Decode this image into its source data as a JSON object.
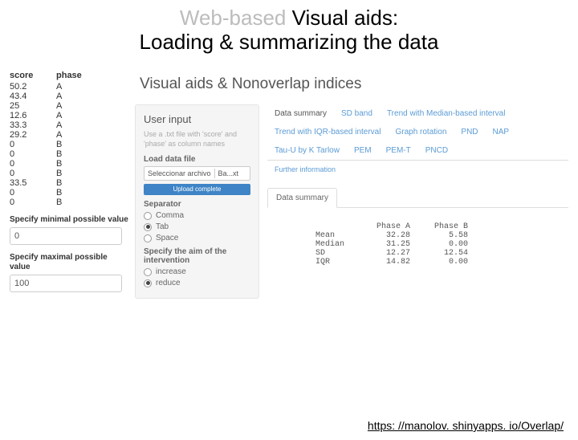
{
  "slide": {
    "title_faded_prefix": "Web-based ",
    "title_rest_line1": "Visual aids:",
    "title_line2": "Loading & summarizing the data"
  },
  "datatable": {
    "headers": {
      "c1": "score",
      "c2": "phase"
    },
    "rows": [
      {
        "score": "50.2",
        "phase": "A"
      },
      {
        "score": "43.4",
        "phase": "A"
      },
      {
        "score": "25",
        "phase": "A"
      },
      {
        "score": "12.6",
        "phase": "A"
      },
      {
        "score": "33.3",
        "phase": "A"
      },
      {
        "score": "29.2",
        "phase": "A"
      },
      {
        "score": "0",
        "phase": "B"
      },
      {
        "score": "0",
        "phase": "B"
      },
      {
        "score": "0",
        "phase": "B"
      },
      {
        "score": "0",
        "phase": "B"
      },
      {
        "score": "33.5",
        "phase": "B"
      },
      {
        "score": "0",
        "phase": "B"
      },
      {
        "score": "0",
        "phase": "B"
      }
    ]
  },
  "specs": {
    "min_label": "Specify minimal possible value",
    "min_value": "0",
    "max_label": "Specify maximal possible value",
    "max_value": "100"
  },
  "app": {
    "title": "Visual aids & Nonoverlap indices",
    "sidebar": {
      "heading": "User input",
      "hint": "Use a .txt file with 'score' and 'phase' as column names",
      "load_label": "Load data file",
      "file_button": "Seleccionar archivo",
      "file_name": "Ba...xt",
      "upload_status": "Upload complete",
      "separator_label": "Separator",
      "separator_options": [
        "Comma",
        "Tab",
        "Space"
      ],
      "separator_selected": "Tab",
      "aim_label": "Specify the aim of the intervention",
      "aim_options": [
        "increase",
        "reduce"
      ],
      "aim_selected": "reduce"
    },
    "tabs": [
      "Data summary",
      "SD band",
      "Trend with Median-based interval",
      "Trend with IQR-based interval",
      "Graph rotation",
      "PND",
      "NAP",
      "Tau-U by K Tarlow",
      "PEM",
      "PEM-T",
      "PNCD"
    ],
    "more_info": "Further information",
    "active_subtab": "Data summary",
    "summary": {
      "cols": [
        "Phase A",
        "Phase B"
      ],
      "rows": [
        {
          "label": "Mean",
          "a": "32.28",
          "b": "5.58"
        },
        {
          "label": "Median",
          "a": "31.25",
          "b": "0.00"
        },
        {
          "label": "SD",
          "a": "12.27",
          "b": "12.54"
        },
        {
          "label": "IQR",
          "a": "14.82",
          "b": "0.00"
        }
      ]
    }
  },
  "footer": {
    "url": "https: //manolov. shinyapps. io/Overlap/"
  }
}
